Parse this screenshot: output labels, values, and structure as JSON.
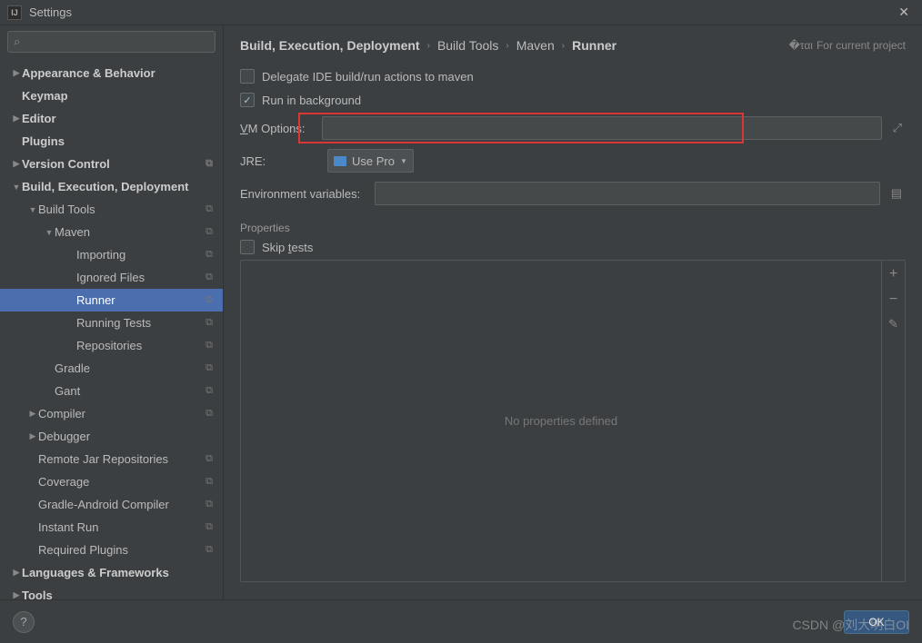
{
  "window": {
    "title": "Settings"
  },
  "search": {
    "placeholder": ""
  },
  "sidebar": {
    "items": [
      {
        "label": "Appearance & Behavior",
        "bold": true,
        "depth": 0,
        "arrow": "▶",
        "badge": false
      },
      {
        "label": "Keymap",
        "bold": true,
        "depth": 0,
        "arrow": "",
        "badge": false
      },
      {
        "label": "Editor",
        "bold": true,
        "depth": 0,
        "arrow": "▶",
        "badge": false
      },
      {
        "label": "Plugins",
        "bold": true,
        "depth": 0,
        "arrow": "",
        "badge": false
      },
      {
        "label": "Version Control",
        "bold": true,
        "depth": 0,
        "arrow": "▶",
        "badge": true
      },
      {
        "label": "Build, Execution, Deployment",
        "bold": true,
        "depth": 0,
        "arrow": "▼",
        "badge": false
      },
      {
        "label": "Build Tools",
        "bold": false,
        "depth": 1,
        "arrow": "▼",
        "badge": true
      },
      {
        "label": "Maven",
        "bold": false,
        "depth": 2,
        "arrow": "▼",
        "badge": true
      },
      {
        "label": "Importing",
        "bold": false,
        "depth": 3,
        "arrow": "",
        "badge": true
      },
      {
        "label": "Ignored Files",
        "bold": false,
        "depth": 3,
        "arrow": "",
        "badge": true
      },
      {
        "label": "Runner",
        "bold": false,
        "depth": 3,
        "arrow": "",
        "badge": true,
        "selected": true
      },
      {
        "label": "Running Tests",
        "bold": false,
        "depth": 3,
        "arrow": "",
        "badge": true
      },
      {
        "label": "Repositories",
        "bold": false,
        "depth": 3,
        "arrow": "",
        "badge": true
      },
      {
        "label": "Gradle",
        "bold": false,
        "depth": 2,
        "arrow": "",
        "badge": true
      },
      {
        "label": "Gant",
        "bold": false,
        "depth": 2,
        "arrow": "",
        "badge": true
      },
      {
        "label": "Compiler",
        "bold": false,
        "depth": 1,
        "arrow": "▶",
        "badge": true
      },
      {
        "label": "Debugger",
        "bold": false,
        "depth": 1,
        "arrow": "▶",
        "badge": false
      },
      {
        "label": "Remote Jar Repositories",
        "bold": false,
        "depth": 1,
        "arrow": "",
        "badge": true
      },
      {
        "label": "Coverage",
        "bold": false,
        "depth": 1,
        "arrow": "",
        "badge": true
      },
      {
        "label": "Gradle-Android Compiler",
        "bold": false,
        "depth": 1,
        "arrow": "",
        "badge": true
      },
      {
        "label": "Instant Run",
        "bold": false,
        "depth": 1,
        "arrow": "",
        "badge": true
      },
      {
        "label": "Required Plugins",
        "bold": false,
        "depth": 1,
        "arrow": "",
        "badge": true
      },
      {
        "label": "Languages & Frameworks",
        "bold": true,
        "depth": 0,
        "arrow": "▶",
        "badge": false
      },
      {
        "label": "Tools",
        "bold": true,
        "depth": 0,
        "arrow": "▶",
        "badge": false
      }
    ]
  },
  "breadcrumb": {
    "items": [
      "Build, Execution, Deployment",
      "Build Tools",
      "Maven",
      "Runner"
    ],
    "hint": "For current project"
  },
  "form": {
    "delegate_label": "Delegate IDE build/run actions to maven",
    "background_label": "Run in background",
    "background_checked": "✓",
    "vm_label_pre": "V",
    "vm_label_post": "M Options:",
    "vm_value": "",
    "jre_label": "JRE:",
    "jre_value": "Use Pro",
    "env_label": "Environment variables:",
    "env_value": "",
    "properties_title": "Properties",
    "skip_pre": "Skip ",
    "skip_u": "t",
    "skip_post": "ests",
    "properties_empty": "No properties defined"
  },
  "footer": {
    "ok": "OK"
  },
  "watermark": "CSDN @刘大明白OI"
}
